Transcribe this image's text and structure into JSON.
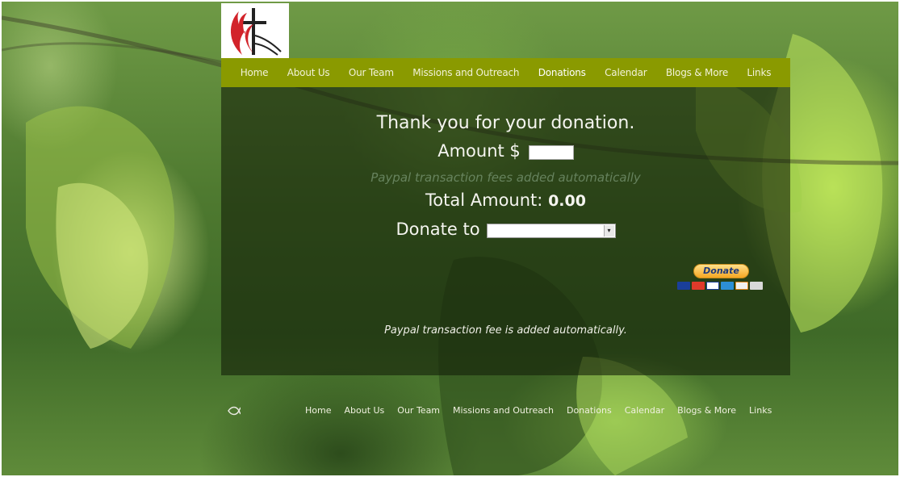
{
  "nav": {
    "items": [
      {
        "label": "Home"
      },
      {
        "label": "About Us"
      },
      {
        "label": "Our Team"
      },
      {
        "label": "Missions and Outreach"
      },
      {
        "label": "Donations"
      },
      {
        "label": "Calendar"
      },
      {
        "label": "Blogs & More"
      },
      {
        "label": "Links"
      }
    ],
    "active": "Donations"
  },
  "donation": {
    "heading": "Thank you for your donation.",
    "amount_label": "Amount $",
    "amount_value": "",
    "fee_note_top": "Paypal transaction fees added automatically",
    "total_label": "Total Amount:",
    "total_value": "0.00",
    "donate_to_label": "Donate to",
    "donate_to_selected": "",
    "donate_button_label": "Donate",
    "fee_note_bottom": "Paypal transaction fee is added automatically."
  },
  "footer": {
    "items": [
      {
        "label": "Home"
      },
      {
        "label": "About Us"
      },
      {
        "label": "Our Team"
      },
      {
        "label": "Missions and Outreach"
      },
      {
        "label": "Donations"
      },
      {
        "label": "Calendar"
      },
      {
        "label": "Blogs & More"
      },
      {
        "label": "Links"
      }
    ]
  },
  "colors": {
    "nav_bar": "#8a9a00",
    "panel": "rgba(20,32,8,0.6)",
    "logo_red": "#d2232a"
  },
  "icons": [
    "cross-and-flame-logo-icon",
    "fish-icon",
    "payment-cards-icon",
    "dropdown-arrow-icon"
  ]
}
